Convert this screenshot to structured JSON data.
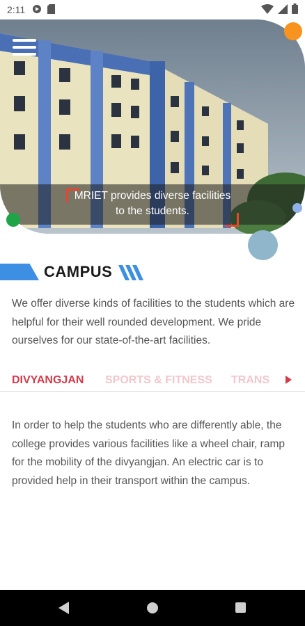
{
  "status_bar": {
    "time": "2:11",
    "left_icons": [
      "media-icon",
      "sd-card-icon"
    ],
    "right_icons": [
      "wifi-icon",
      "signal-icon",
      "battery-icon"
    ]
  },
  "hero": {
    "image": "college-building-photo",
    "caption_line1": "MRIET provides diverse facilities",
    "caption_line2": "to the students."
  },
  "section": {
    "title": "CAMPUS",
    "intro": "We offer diverse kinds of facilities to the students which are helpful for their well rounded development. We pride ourselves for our state-of-the-art facilities."
  },
  "tabs": [
    {
      "label": "DIVYANGJAN",
      "active": true
    },
    {
      "label": "SPORTS & FITNESS",
      "active": false
    },
    {
      "label": "TRANS",
      "active": false
    }
  ],
  "tab_content": "In order to help the students who are differently able, the college provides various facilities like a wheel chair, ramp for the mobility of the divyangjan. An electric car is to provided help in their transport within the campus.",
  "colors": {
    "accent_red": "#d73a49",
    "accent_blue": "#3d8fe3",
    "orange": "#f7931e",
    "green": "#1fa447"
  }
}
